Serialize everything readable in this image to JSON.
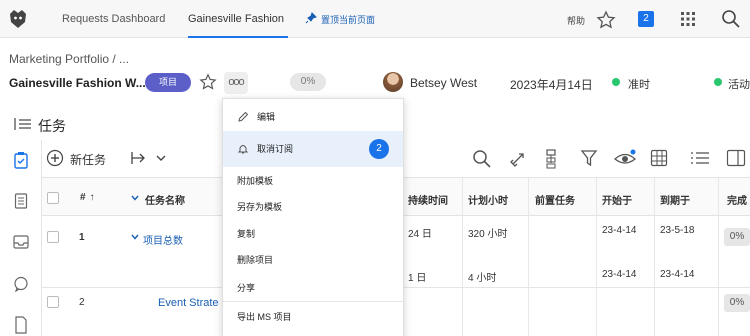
{
  "topbar": {
    "tabs": [
      {
        "label": "Requests Dashboard"
      },
      {
        "label": "Gainesville Fashion ..."
      }
    ],
    "pin_label": "置顶当前页面",
    "help_label": "帮助",
    "notifications_count": "2"
  },
  "header": {
    "breadcrumb": "Marketing Portfolio  /  ...",
    "project_title": "Gainesville Fashion W...",
    "type_pill": "项目",
    "more_label": "ooo",
    "progress": "0%",
    "owner": "Betsey West",
    "date": "2023年4月14日",
    "status_on_time": "准时",
    "status_active": "活动"
  },
  "section": {
    "title": "任务"
  },
  "toolbar": {
    "new_task": "新任务"
  },
  "table": {
    "headers": {
      "num": "#",
      "name": "任务名称",
      "duration": "持续时间",
      "planned_hours": "计划小时",
      "predecessors": "前置任务",
      "start": "开始于",
      "due": "到期于",
      "complete": "完成"
    },
    "rows": [
      {
        "num": "1",
        "name": "项目总数",
        "duration": "24 日",
        "hours": "320 小时",
        "start": "23-4-14",
        "due": "23-5-18",
        "pct": "0%",
        "duration2": "1 日",
        "hours2": "4 小时",
        "start2": "23-4-14",
        "due2": "23-4-14"
      },
      {
        "num": "2",
        "name": "Event Strate",
        "pct": "0%"
      }
    ]
  },
  "menu": {
    "items": [
      {
        "label": "编辑"
      },
      {
        "label": "取消订阅",
        "badge": "2"
      },
      {
        "label": "附加模板"
      },
      {
        "label": "另存为模板"
      },
      {
        "label": "复制"
      },
      {
        "label": "删除项目"
      },
      {
        "label": "分享"
      },
      {
        "label": "导出 MS 项目"
      }
    ]
  },
  "colors": {
    "accent": "#1a73e8",
    "pill": "#5b5fc7",
    "status_green": "#28c76f"
  }
}
